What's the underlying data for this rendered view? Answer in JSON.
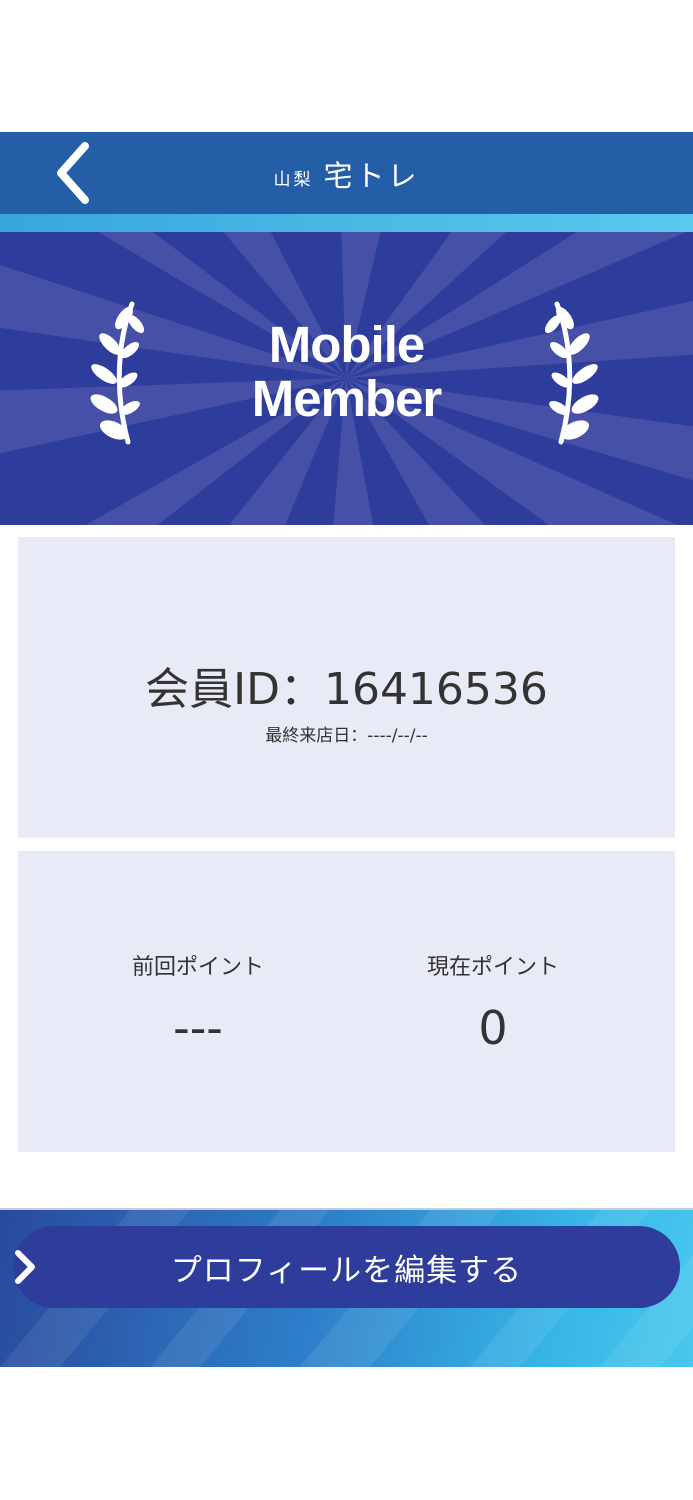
{
  "header": {
    "logo_sub": "山梨",
    "logo_main": "宅トレ",
    "back_icon": "chevron-left-icon"
  },
  "banner": {
    "line1": "Mobile",
    "line2": "Member",
    "left_icon": "laurel-left-icon",
    "right_icon": "laurel-right-icon"
  },
  "member": {
    "id_text": "会員ID：16416536",
    "last_visit": "最終来店日：----/--/--"
  },
  "points": {
    "previous_label": "前回ポイント",
    "previous_value": "---",
    "current_label": "現在ポイント",
    "current_value": "0"
  },
  "footer": {
    "edit_label": "プロフィールを編集する",
    "edit_icon": "chevron-right-icon"
  },
  "colors": {
    "header": "#245ea6",
    "accent_stripe": "#5cc8ee",
    "banner": "#2e3c9c",
    "card": "#e8eaf5",
    "button": "#2e3c9c"
  }
}
